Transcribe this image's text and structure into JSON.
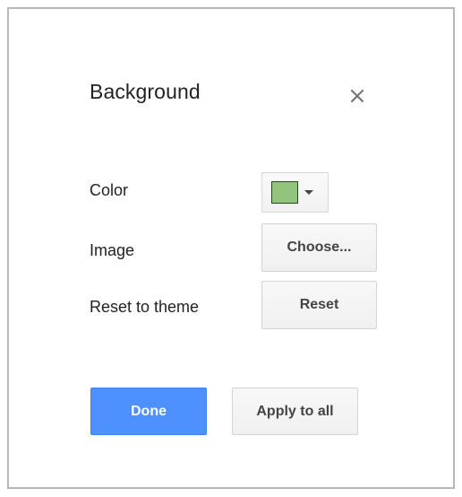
{
  "dialog": {
    "title": "Background",
    "close_icon": "close-icon"
  },
  "rows": {
    "color_label": "Color",
    "image_label": "Image",
    "reset_label": "Reset to theme"
  },
  "color": {
    "swatch_color": "#93c47d",
    "dropdown_icon": "caret-down-icon"
  },
  "buttons": {
    "choose": "Choose...",
    "reset": "Reset",
    "done": "Done",
    "apply_to_all": "Apply to all"
  },
  "colors": {
    "primary": "#4d90fe",
    "text": "#222222",
    "button_text": "#444444"
  }
}
